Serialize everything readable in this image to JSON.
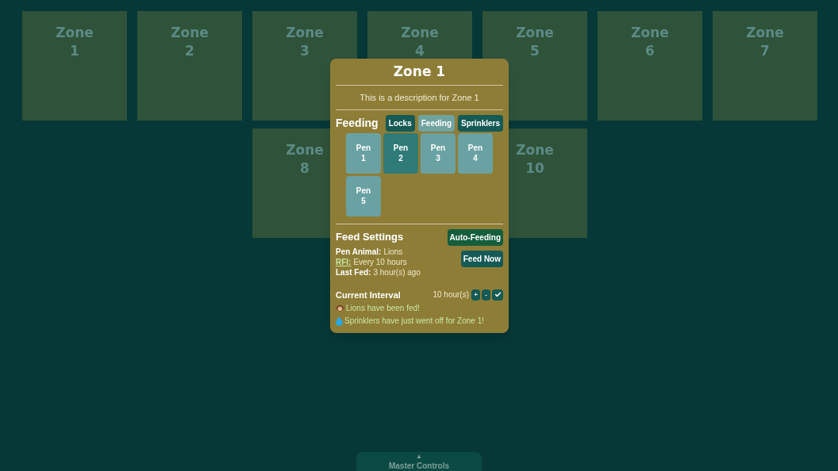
{
  "zones": [
    {
      "label": "Zone 1"
    },
    {
      "label": "Zone 2"
    },
    {
      "label": "Zone 3"
    },
    {
      "label": "Zone 4"
    },
    {
      "label": "Zone 5"
    },
    {
      "label": "Zone 6"
    },
    {
      "label": "Zone 7"
    },
    {
      "label": "Zone 8"
    },
    {
      "label": "Zone 10"
    }
  ],
  "popup": {
    "title": "Zone 1",
    "description": "This is a description for Zone 1",
    "section": "Feeding",
    "tabs": [
      {
        "label": "Locks",
        "selected": false
      },
      {
        "label": "Feeding",
        "selected": true
      },
      {
        "label": "Sprinklers",
        "selected": false
      }
    ],
    "pens": [
      {
        "label": "Pen 1",
        "selected": false
      },
      {
        "label": "Pen 2",
        "selected": true
      },
      {
        "label": "Pen 3",
        "selected": false
      },
      {
        "label": "Pen 4",
        "selected": false
      },
      {
        "label": "Pen 5",
        "selected": false
      }
    ],
    "settings_title": "Feed Settings",
    "details": [
      {
        "label": "Pen Animal:",
        "value": "Lions",
        "kind": "plain"
      },
      {
        "label": "RFI:",
        "value": "Every 10 hours",
        "kind": "link"
      },
      {
        "label": "Last Fed:",
        "value": "3 hour(s) ago",
        "kind": "plain"
      }
    ],
    "buttons": [
      {
        "label": "Auto-Feeding",
        "kind": "toggle"
      },
      {
        "label": "Feed Now",
        "kind": "action"
      }
    ],
    "interval_label": "Current Interval",
    "interval_value": "10 hour(s)",
    "interval_controls": [
      {
        "label": "+",
        "kind": "text"
      },
      {
        "label": "-",
        "kind": "text"
      },
      {
        "kind": "check"
      }
    ],
    "messages": [
      {
        "text": "Lions have been fed!",
        "kind": "monkey"
      },
      {
        "text": "Sprinklers have just went off for Zone 1!",
        "kind": "droplet"
      }
    ]
  },
  "master": {
    "arrow": "▲",
    "label": "Master Controls"
  }
}
